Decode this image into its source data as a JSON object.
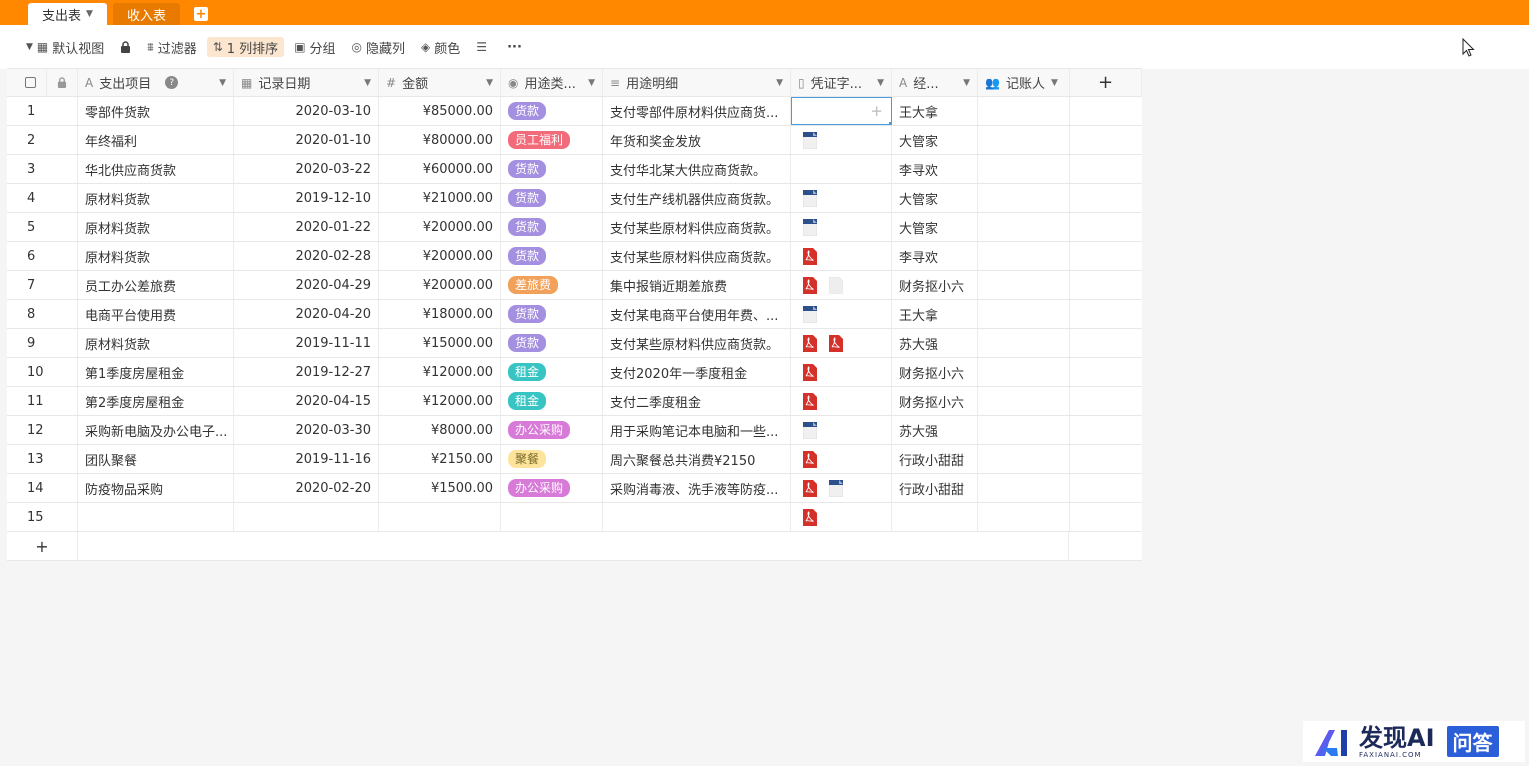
{
  "tabs": [
    {
      "label": "支出表",
      "active": true
    },
    {
      "label": "收入表",
      "active": false
    }
  ],
  "toolbar": {
    "view": "默认视图",
    "filter": "过滤器",
    "sort": "1 列排序",
    "group": "分组",
    "hide": "隐藏列",
    "color": "颜色",
    "more": "···"
  },
  "columns": {
    "name": "支出项目",
    "date": "记录日期",
    "amount": "金额",
    "type": "用途类...",
    "desc": "用途明细",
    "attach": "凭证字...",
    "manager": "经...",
    "recorder": "记账人"
  },
  "tag_colors": {
    "货款": "#a48fe0",
    "员工福利": "#f26b7a",
    "差旅费": "#f2a15b",
    "租金": "#39c4c4",
    "办公采购": "#d77ad8",
    "聚餐": "#fde49a"
  },
  "rows": [
    {
      "num": "1",
      "name": "零部件货款",
      "date": "2020-03-10",
      "amount": "¥85000.00",
      "type": "货款",
      "desc": "支付零部件原材料供应商货...",
      "attachments": [],
      "manager": "王大拿",
      "selected": true
    },
    {
      "num": "2",
      "name": "年终福利",
      "date": "2020-01-10",
      "amount": "¥80000.00",
      "type": "员工福利",
      "desc": "年货和奖金发放",
      "attachments": [
        "doc"
      ],
      "manager": "大管家"
    },
    {
      "num": "3",
      "name": "华北供应商货款",
      "date": "2020-03-22",
      "amount": "¥60000.00",
      "type": "货款",
      "desc": "支付华北某大供应商货款。",
      "attachments": [],
      "manager": "李寻欢"
    },
    {
      "num": "4",
      "name": "原材料货款",
      "date": "2019-12-10",
      "amount": "¥21000.00",
      "type": "货款",
      "desc": "支付生产线机器供应商货款。",
      "attachments": [
        "doc"
      ],
      "manager": "大管家"
    },
    {
      "num": "5",
      "name": "原材料货款",
      "date": "2020-01-22",
      "amount": "¥20000.00",
      "type": "货款",
      "desc": "支付某些原材料供应商货款。",
      "attachments": [
        "doc"
      ],
      "manager": "大管家"
    },
    {
      "num": "6",
      "name": "原材料货款",
      "date": "2020-02-28",
      "amount": "¥20000.00",
      "type": "货款",
      "desc": "支付某些原材料供应商货款。",
      "attachments": [
        "pdf"
      ],
      "manager": "李寻欢"
    },
    {
      "num": "7",
      "name": "员工办公差旅费",
      "date": "2020-04-29",
      "amount": "¥20000.00",
      "type": "差旅费",
      "desc": "集中报销近期差旅费",
      "attachments": [
        "pdf",
        "blank"
      ],
      "manager": "财务抠小六"
    },
    {
      "num": "8",
      "name": "电商平台使用费",
      "date": "2020-04-20",
      "amount": "¥18000.00",
      "type": "货款",
      "desc": "支付某电商平台使用年费、...",
      "attachments": [
        "doc"
      ],
      "manager": "王大拿"
    },
    {
      "num": "9",
      "name": "原材料货款",
      "date": "2019-11-11",
      "amount": "¥15000.00",
      "type": "货款",
      "desc": "支付某些原材料供应商货款。",
      "attachments": [
        "pdf",
        "pdf"
      ],
      "manager": "苏大强"
    },
    {
      "num": "10",
      "name": "第1季度房屋租金",
      "date": "2019-12-27",
      "amount": "¥12000.00",
      "type": "租金",
      "desc": "支付2020年一季度租金",
      "attachments": [
        "pdf"
      ],
      "manager": "财务抠小六"
    },
    {
      "num": "11",
      "name": "第2季度房屋租金",
      "date": "2020-04-15",
      "amount": "¥12000.00",
      "type": "租金",
      "desc": "支付二季度租金",
      "attachments": [
        "pdf"
      ],
      "manager": "财务抠小六"
    },
    {
      "num": "12",
      "name": "采购新电脑及办公电子...",
      "date": "2020-03-30",
      "amount": "¥8000.00",
      "type": "办公采购",
      "desc": "用于采购笔记本电脑和一些...",
      "attachments": [
        "doc"
      ],
      "manager": "苏大强"
    },
    {
      "num": "13",
      "name": "团队聚餐",
      "date": "2019-11-16",
      "amount": "¥2150.00",
      "type": "聚餐",
      "desc": "周六聚餐总共消费¥2150",
      "attachments": [
        "pdf"
      ],
      "manager": "行政小甜甜"
    },
    {
      "num": "14",
      "name": "防疫物品采购",
      "date": "2020-02-20",
      "amount": "¥1500.00",
      "type": "办公采购",
      "desc": "采购消毒液、洗手液等防疫...",
      "attachments": [
        "pdf",
        "doc"
      ],
      "manager": "行政小甜甜"
    },
    {
      "num": "15",
      "name": "",
      "date": "",
      "amount": "",
      "type": "",
      "desc": "",
      "attachments": [
        "pdf"
      ],
      "manager": ""
    }
  ],
  "add_row_label": "+",
  "add_column_label": "+",
  "watermark": {
    "main": "发现AI",
    "sub": "FAXIANAI.COM",
    "button": "问答"
  }
}
